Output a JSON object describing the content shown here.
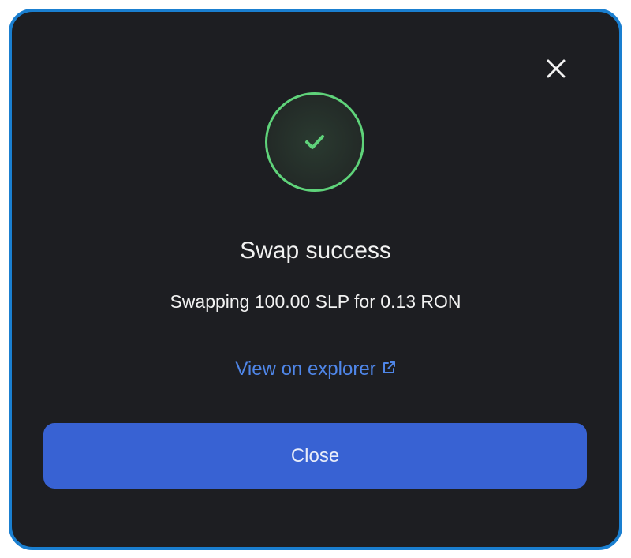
{
  "dialog": {
    "title": "Swap success",
    "message": "Swapping 100.00 SLP for 0.13 RON",
    "explorer_link_label": "View on explorer",
    "close_button_label": "Close"
  },
  "icons": {
    "dismiss": "close-icon",
    "status": "checkmark-icon",
    "external": "external-link-icon"
  },
  "colors": {
    "background": "#1d1e22",
    "frame_border": "#1a7fd0",
    "success": "#5fd37a",
    "link": "#4f86e8",
    "primary_button": "#3862d3"
  }
}
